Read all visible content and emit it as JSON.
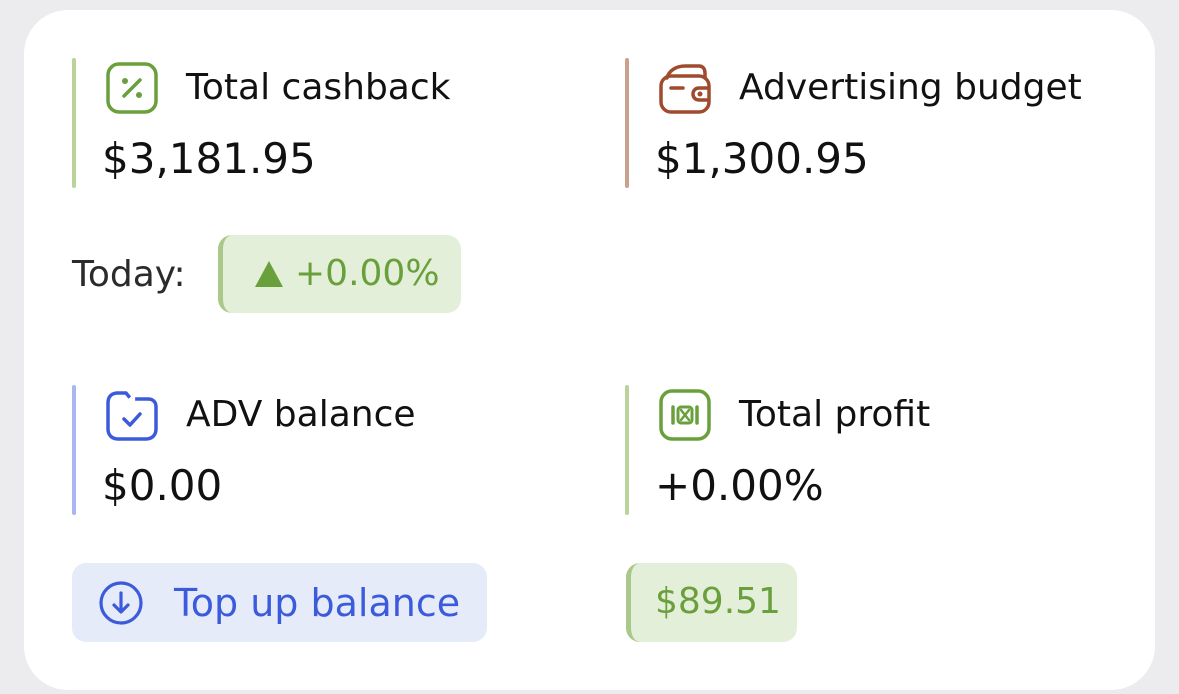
{
  "stats": {
    "cashback": {
      "label": "Total cashback",
      "value": "$3,181.95",
      "icon": "percent-badge-icon",
      "color": "#b9d39b"
    },
    "advertising": {
      "label": "Advertising budget",
      "value": "$1,300.95",
      "icon": "wallet-icon",
      "color": "#caa08f"
    },
    "adv_balance": {
      "label": "ADV balance",
      "value": "$0.00",
      "icon": "folder-check-icon",
      "color": "#a9b6ef"
    },
    "profit": {
      "label": "Total profit",
      "value": "+0.00%",
      "icon": "money-icon",
      "color": "#b9d39b"
    }
  },
  "today": {
    "label": "Today:",
    "change": "+0.00%",
    "trend_icon": "triangle-up-icon"
  },
  "topup": {
    "label": "Top up balance",
    "icon": "download-circle-icon"
  },
  "profit_badge": {
    "value": "$89.51"
  },
  "colors": {
    "green": "#6aa03c",
    "brown": "#a04a2e",
    "blue": "#3b5bdb"
  }
}
